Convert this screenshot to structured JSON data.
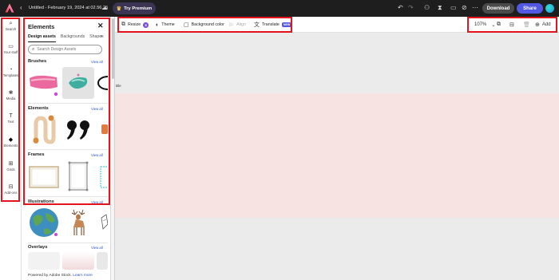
{
  "topbar": {
    "logo_icon": "adobe-express-logo",
    "back_icon": "chevron-left-icon",
    "doc_title": "Untitled - February 19, 2024 at 02.56.25",
    "cloud_icon": "cloud-icon",
    "premium_label": "Try Premium",
    "download_label": "Download",
    "share_label": "Share",
    "accent": "#5258e4"
  },
  "rail": {
    "items": [
      {
        "icon": "search-icon",
        "label": "Search"
      },
      {
        "icon": "folder-icon",
        "label": "Your stuff"
      },
      {
        "icon": "templates-icon",
        "label": "Templates"
      },
      {
        "icon": "media-icon",
        "label": "Media"
      },
      {
        "icon": "text-icon",
        "label": "Text"
      },
      {
        "icon": "elements-icon",
        "label": "Elements"
      },
      {
        "icon": "grids-icon",
        "label": "Grids"
      },
      {
        "icon": "add-ons-icon",
        "label": "Add-ons"
      }
    ]
  },
  "panel": {
    "title": "Elements",
    "tabs": [
      "Design assets",
      "Backgrounds",
      "Shapes"
    ],
    "search_placeholder": "Search Design Assets",
    "sections": [
      {
        "title": "Brushes",
        "view_all": "View all"
      },
      {
        "title": "Elements",
        "view_all": "View all"
      },
      {
        "title": "Frames",
        "view_all": "View all"
      },
      {
        "title": "Illustrations",
        "view_all": "View all"
      },
      {
        "title": "Overlays",
        "view_all": "View all"
      }
    ],
    "footer_text": "Powered by Adobe Stock.",
    "footer_link": "Learn more"
  },
  "toolbar": {
    "resize": "Resize",
    "theme": "Theme",
    "background_color": "Background color",
    "align": "Align",
    "translate": "Translate",
    "new_badge": "NEW",
    "zoom": "107%",
    "add": "Add"
  },
  "canvas": {
    "title_label": "title",
    "page_color": "#f7e4e2"
  }
}
